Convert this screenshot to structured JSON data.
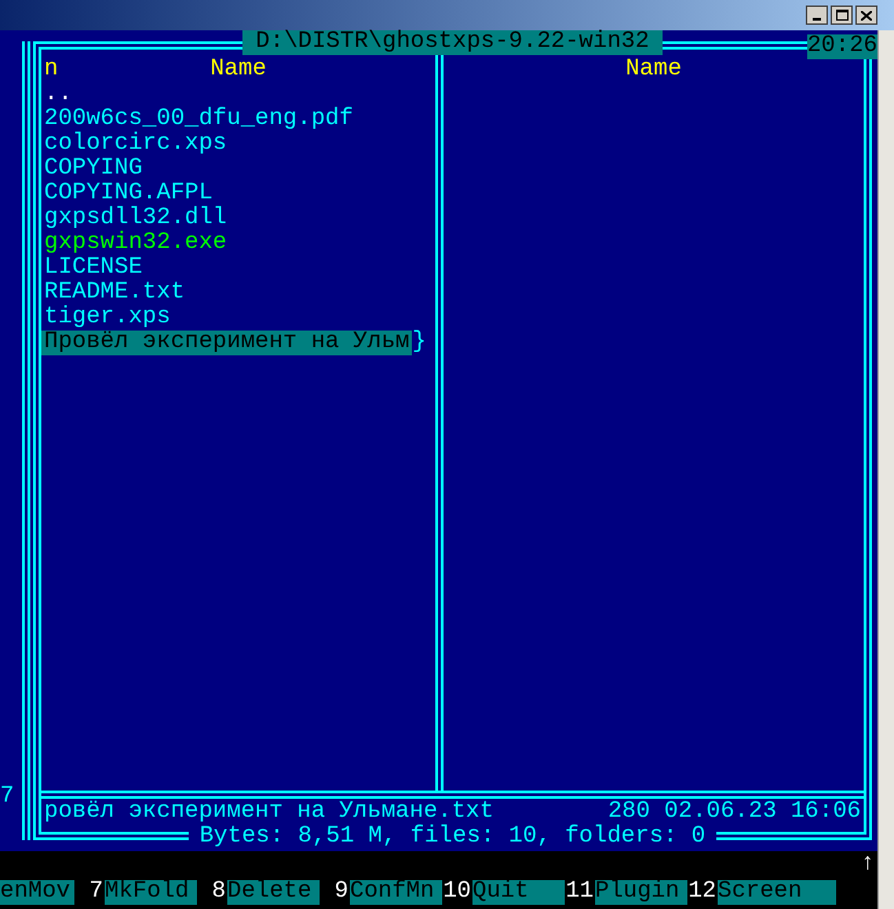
{
  "panel": {
    "path": "D:\\DISTR\\ghostxps-9.22-win32",
    "clock": "20:26"
  },
  "side_panel_fragment": "7",
  "left_panel": {
    "sort_mark": "n",
    "column_header": "Name",
    "files": [
      {
        "name": "..",
        "kind": "up",
        "selected": false
      },
      {
        "name": "200w6cs_00_dfu_eng.pdf",
        "kind": "file",
        "selected": false
      },
      {
        "name": "colorcirc.xps",
        "kind": "file",
        "selected": false
      },
      {
        "name": "COPYING",
        "kind": "file",
        "selected": false
      },
      {
        "name": "COPYING.AFPL",
        "kind": "file",
        "selected": false
      },
      {
        "name": "gxpsdll32.dll",
        "kind": "file",
        "selected": false
      },
      {
        "name": "gxpswin32.exe",
        "kind": "exe",
        "selected": false
      },
      {
        "name": "LICENSE",
        "kind": "file",
        "selected": false
      },
      {
        "name": "README.txt",
        "kind": "file",
        "selected": false
      },
      {
        "name": "tiger.xps",
        "kind": "file",
        "selected": false
      },
      {
        "name": "Провёл эксперимент на Ульм",
        "kind": "file",
        "selected": true,
        "truncation_mark": "}"
      }
    ]
  },
  "right_panel": {
    "column_header": "Name"
  },
  "info_line": {
    "name": "ровёл эксперимент на Ульмане.txt",
    "details": "280 02.06.23 16:06"
  },
  "totals": "Bytes: 8,51 M, files: 10, folders: 0",
  "scroll_mark": "↑",
  "keybar": [
    {
      "label": "enMov"
    },
    {
      "key": "7",
      "label": "MkFold"
    },
    {
      "key": "8",
      "label": "Delete"
    },
    {
      "key": "9",
      "label": "ConfMn"
    },
    {
      "key": "10",
      "label": "Quit"
    },
    {
      "key": "11",
      "label": "Plugin"
    },
    {
      "key": "12",
      "label": "Screen"
    }
  ]
}
